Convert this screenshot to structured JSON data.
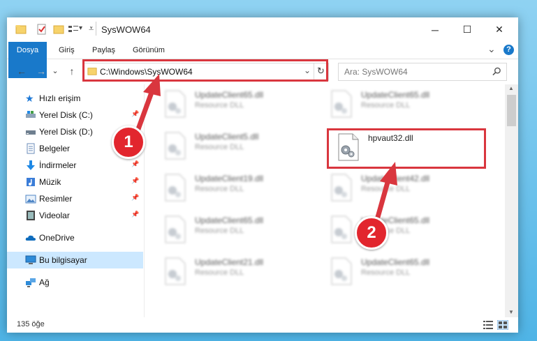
{
  "window": {
    "title": "SysWOW64",
    "controls": {
      "minimize": "─",
      "maximize": "☐",
      "close": "✕"
    }
  },
  "ribbon": {
    "tabs": [
      "Dosya",
      "Giriş",
      "Paylaş",
      "Görünüm"
    ],
    "collapse_icon": "⌄",
    "help_icon": "?"
  },
  "nav": {
    "back": "←",
    "forward": "→",
    "recent": "⌄",
    "up": "↑",
    "address": "C:\\Windows\\SysWOW64",
    "search_placeholder": "Ara: SysWOW64"
  },
  "sidebar": {
    "items": [
      {
        "label": "Hızlı erişim",
        "icon": "star-icon"
      },
      {
        "label": "Yerel Disk (C:)",
        "icon": "drive-icon"
      },
      {
        "label": "Yerel Disk (D:)",
        "icon": "drive-icon"
      },
      {
        "label": "Belgeler",
        "icon": "documents-icon"
      },
      {
        "label": "İndirmeler",
        "icon": "download-icon"
      },
      {
        "label": "Müzik",
        "icon": "music-icon"
      },
      {
        "label": "Resimler",
        "icon": "pictures-icon"
      },
      {
        "label": "Videolar",
        "icon": "video-icon"
      },
      {
        "label": "OneDrive",
        "icon": "cloud-icon"
      },
      {
        "label": "Bu bilgisayar",
        "icon": "computer-icon"
      },
      {
        "label": "Ağ",
        "icon": "network-icon"
      }
    ]
  },
  "files": [
    {
      "name": "UpdateClient65.dll",
      "type": "Resource DLL"
    },
    {
      "name": "UpdateClient65.dll",
      "type": "Resource DLL"
    },
    {
      "name": "UpdateClient5.dll",
      "type": "Resource DLL"
    },
    {
      "name": "hpvaut32.dll",
      "type": ""
    },
    {
      "name": "UpdateClient19.dll",
      "type": "Resource DLL"
    },
    {
      "name": "UpdateClient42.dll",
      "type": "Resource DLL"
    },
    {
      "name": "UpdateClient65.dll",
      "type": "Resource DLL"
    },
    {
      "name": "UpdateClient65.dll",
      "type": "Resource DLL"
    },
    {
      "name": "UpdateClient21.dll",
      "type": "Resource DLL"
    },
    {
      "name": "UpdateClient65.dll",
      "type": "Resource DLL"
    }
  ],
  "status": {
    "item_count": "135 öğe"
  },
  "annotations": {
    "step1": "1",
    "step2": "2"
  },
  "colors": {
    "accent": "#1979ca",
    "highlight": "#d9363e",
    "selected": "#cce8ff"
  }
}
